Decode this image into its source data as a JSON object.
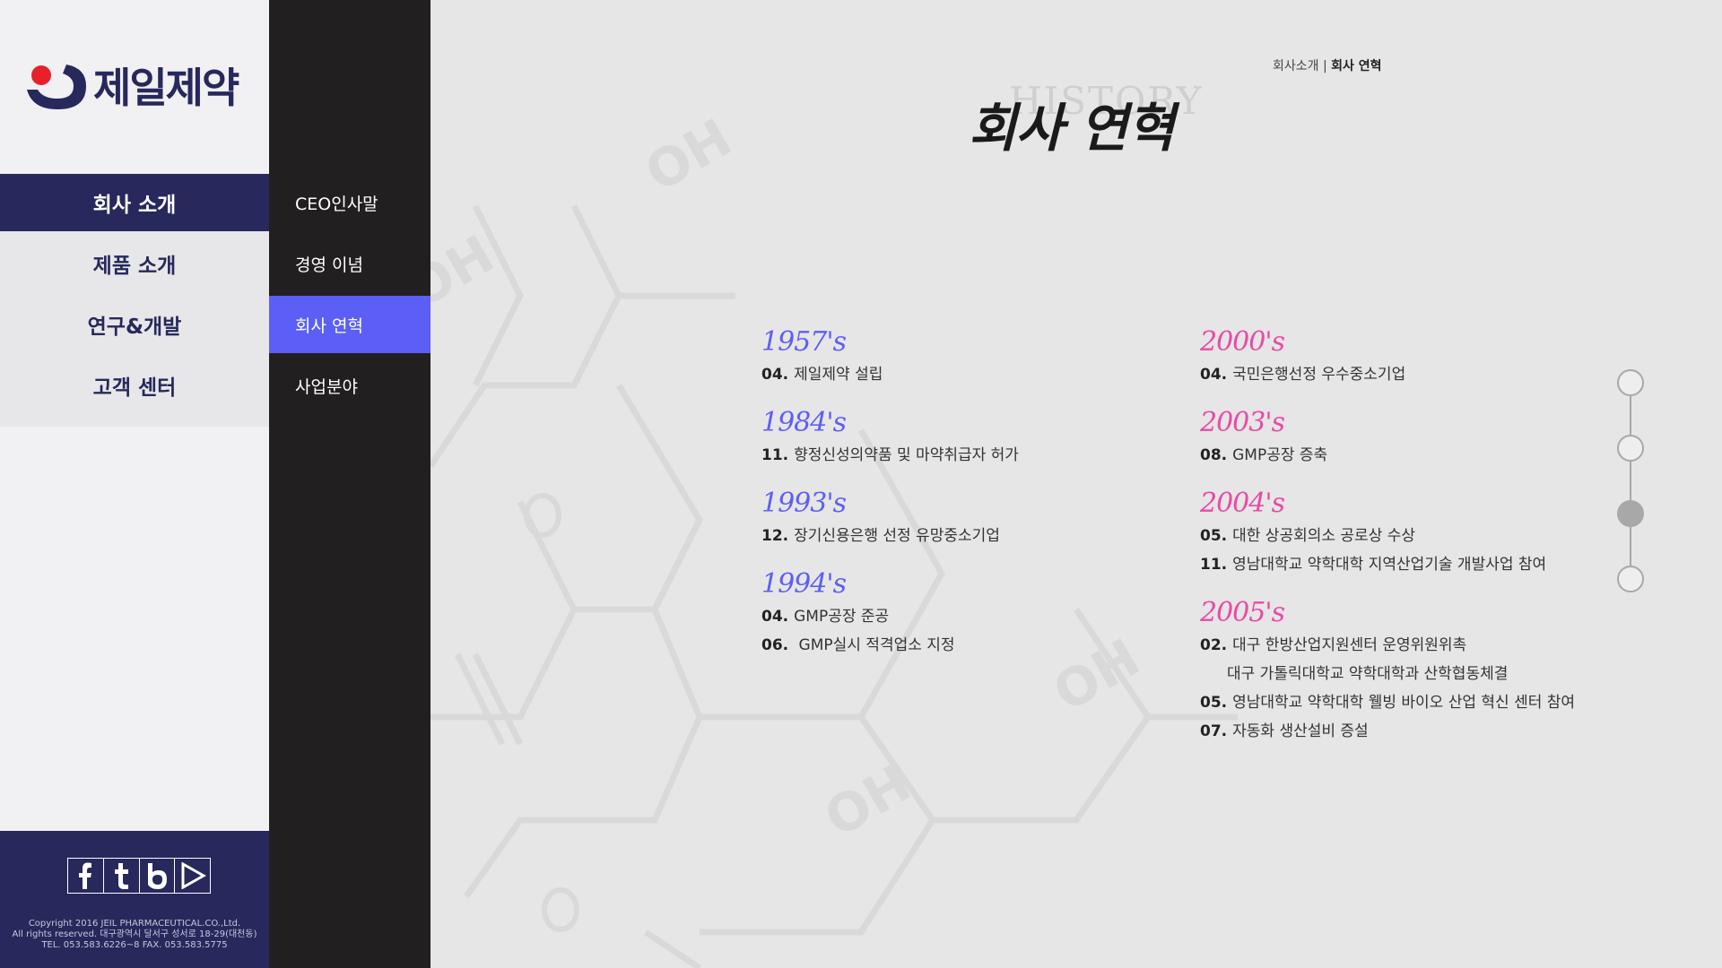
{
  "brand": {
    "name": "제일제약",
    "logo_colors": {
      "navy": "#27285c",
      "red": "#e8202a"
    }
  },
  "main_nav": {
    "items": [
      {
        "label": "회사 소개",
        "active": true
      },
      {
        "label": "제품 소개",
        "active": false
      },
      {
        "label": "연구&개발",
        "active": false
      },
      {
        "label": "고객 센터",
        "active": false
      }
    ]
  },
  "sub_nav": {
    "items": [
      {
        "label": "CEO인사말",
        "active": false
      },
      {
        "label": "경영 이념",
        "active": false
      },
      {
        "label": "회사 연혁",
        "active": true
      },
      {
        "label": "사업분야",
        "active": false
      }
    ]
  },
  "social": {
    "icons": [
      "facebook-icon",
      "tumblr-icon",
      "blog-icon",
      "youtube-icon"
    ]
  },
  "footer": {
    "line1": "Copyright 2016 JEIL PHARMACEUTICAL.CO.,Ltd.",
    "line2": "All rights reserved. 대구광역시 달서구 성서로 18-29(대천동)",
    "line3": "TEL. 053.583.6226~8 FAX. 053.583.5775"
  },
  "breadcrumb": {
    "parent": "회사소개",
    "separator": "|",
    "current": "회사 연혁"
  },
  "page": {
    "title_ghost": "HISTORY",
    "title": "회사 연혁"
  },
  "timeline": {
    "left": [
      {
        "year": "1957's",
        "events": [
          {
            "month": "04.",
            "text": "제일제약 설립"
          }
        ]
      },
      {
        "year": "1984's",
        "events": [
          {
            "month": "11.",
            "text": "향정신성의약품 및 마약취급자 허가"
          }
        ]
      },
      {
        "year": "1993's",
        "events": [
          {
            "month": "12.",
            "text": "장기신용은행 선정 유망중소기업"
          }
        ]
      },
      {
        "year": "1994's",
        "events": [
          {
            "month": "04.",
            "text": "GMP공장 준공"
          },
          {
            "month": "06.",
            "text": " GMP실시 적격업소 지정"
          }
        ]
      }
    ],
    "right": [
      {
        "year": "2000's",
        "events": [
          {
            "month": "04.",
            "text": "국민은행선정 우수중소기업"
          }
        ]
      },
      {
        "year": "2003's",
        "events": [
          {
            "month": "08.",
            "text": "GMP공장 증축"
          }
        ]
      },
      {
        "year": "2004's",
        "events": [
          {
            "month": "05.",
            "text": "대한 상공회의소 공로상 수상"
          },
          {
            "month": "11.",
            "text": "영남대학교 약학대학 지역산업기술 개발사업 참여"
          }
        ]
      },
      {
        "year": "2005's",
        "events": [
          {
            "month": "02.",
            "text": "대구 한방산업지원센터 운영위원위촉"
          },
          {
            "month": "",
            "text": "대구 가톨릭대학교 약학대학과 산학협동체결"
          },
          {
            "month": "05.",
            "text": "영남대학교 약학대학 웰빙 바이오 산업 혁신 센터 참여"
          },
          {
            "month": "07.",
            "text": "자동화 생산설비 증설"
          }
        ]
      }
    ]
  },
  "pager": {
    "count": 4,
    "active_index": 2
  },
  "colors": {
    "accent_blue": "#5c5ff5",
    "accent_pink": "#e94aa5",
    "navy": "#27285c",
    "dark": "#221f20"
  }
}
